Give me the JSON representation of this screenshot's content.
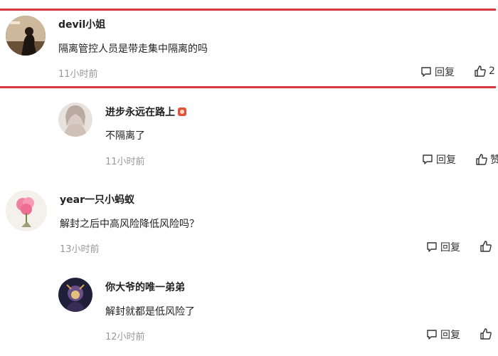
{
  "comments": [
    {
      "username": "devil小姐",
      "content": "隔离管控人员是带走集中隔离的吗",
      "time": "11小时前",
      "reply_label": "回复",
      "like_label": "2"
    },
    {
      "username": "进步永远在路上",
      "content": "不隔离了",
      "time": "11小时前",
      "reply_label": "回复",
      "like_label": "赞"
    },
    {
      "username": "year一只小蚂蚁",
      "content": "解封之后中高风险降低风险吗？",
      "time": "13小时前",
      "reply_label": "回复",
      "like_label": ""
    },
    {
      "username": "你大爷的唯一弟弟",
      "content": "解封就都是低风险了",
      "time": "12小时前",
      "reply_label": "回复",
      "like_label": ""
    }
  ],
  "colors": {
    "highlight_border": "#d9363e",
    "time_text": "#999999",
    "badge": "#e0523a"
  },
  "icons": {
    "reply": "comment-bubble-icon",
    "like": "thumbs-up-icon",
    "badge": "level-badge-icon"
  }
}
